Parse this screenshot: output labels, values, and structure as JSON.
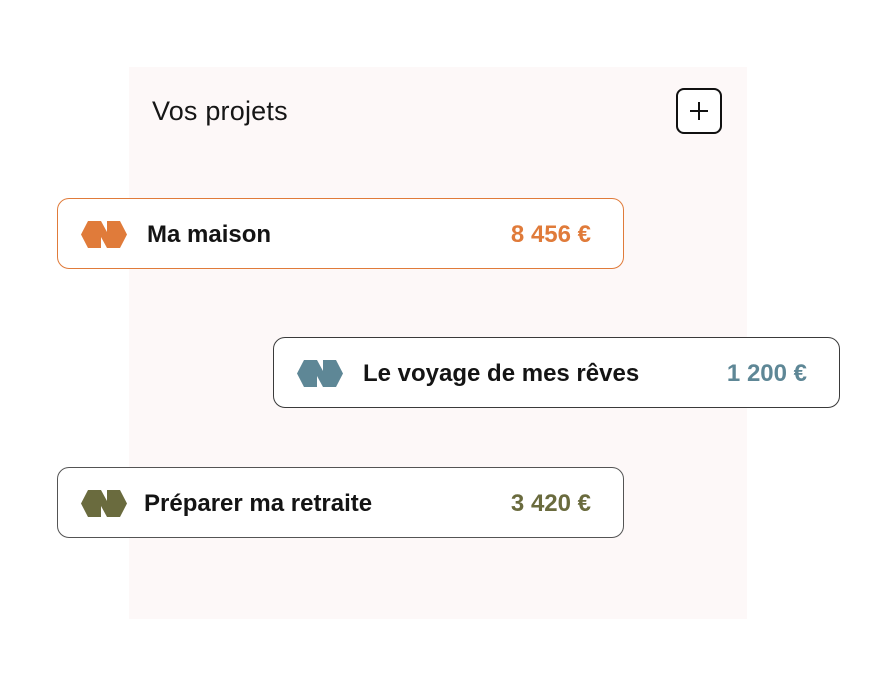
{
  "panel": {
    "title": "Vos projets",
    "add_button_icon": "plus-icon"
  },
  "projects": [
    {
      "name": "Ma maison",
      "amount": "8 456 €",
      "color": "#e07b3a",
      "icon": "project-logo-icon"
    },
    {
      "name": "Le voyage de mes rêves",
      "amount": "1 200 €",
      "color": "#5e8796",
      "icon": "project-logo-icon"
    },
    {
      "name": "Préparer ma retraite",
      "amount": "3 420 €",
      "color": "#6a6b3e",
      "icon": "project-logo-icon"
    }
  ]
}
